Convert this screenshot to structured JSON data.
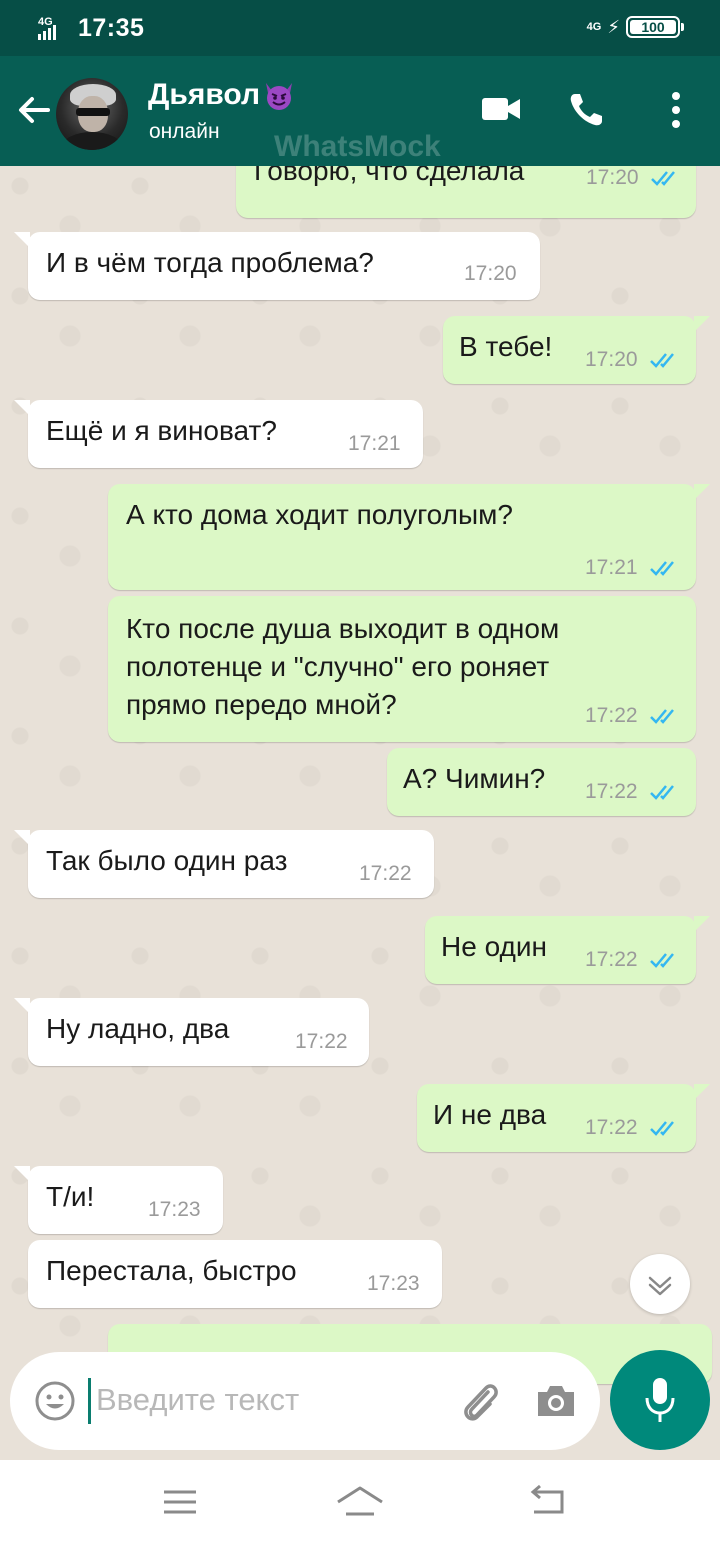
{
  "status_bar": {
    "time": "17:35",
    "left_network": "4G",
    "right_network": "4G",
    "battery": "100"
  },
  "header": {
    "contact_name": "Дьявол",
    "status": "онлайн",
    "watermark": "WhatsMock",
    "icons": [
      "back-arrow-icon",
      "video-call-icon",
      "phone-call-icon",
      "more-options-icon"
    ]
  },
  "messages": [
    {
      "dir": "out",
      "text": "Говорю, что сделала",
      "time": "17:20"
    },
    {
      "dir": "in",
      "text": "И в чём тогда проблема?",
      "time": "17:20"
    },
    {
      "dir": "out",
      "text": "В тебе!",
      "time": "17:20"
    },
    {
      "dir": "in",
      "text": "Ещё и я виноват?",
      "time": "17:21"
    },
    {
      "dir": "out",
      "text": "А кто дома ходит полуголым?",
      "time": "17:21"
    },
    {
      "dir": "out",
      "lines": [
        "Кто после душа выходит в одном",
        "полотенце и \"случно\" его роняет",
        "прямо передо мной?"
      ],
      "time": "17:22"
    },
    {
      "dir": "out",
      "text": "А? Чимин?",
      "time": "17:22"
    },
    {
      "dir": "in",
      "text": "Так было один раз",
      "time": "17:22"
    },
    {
      "dir": "out",
      "text": "Не один",
      "time": "17:22"
    },
    {
      "dir": "in",
      "text": "Ну ладно, два",
      "time": "17:22"
    },
    {
      "dir": "out",
      "text": "И не два",
      "time": "17:22"
    },
    {
      "dir": "in",
      "text": "Т/и!",
      "time": "17:23"
    },
    {
      "dir": "in",
      "text": "Перестала, быстро",
      "time": "17:23"
    }
  ],
  "input": {
    "placeholder": "Введите текст"
  },
  "colors": {
    "header": "#075e54",
    "status_bar": "#064e46",
    "outgoing_bubble": "#dcf8c6",
    "incoming_bubble": "#ffffff",
    "read_ticks": "#34b7f1",
    "mic_button": "#00897b"
  }
}
